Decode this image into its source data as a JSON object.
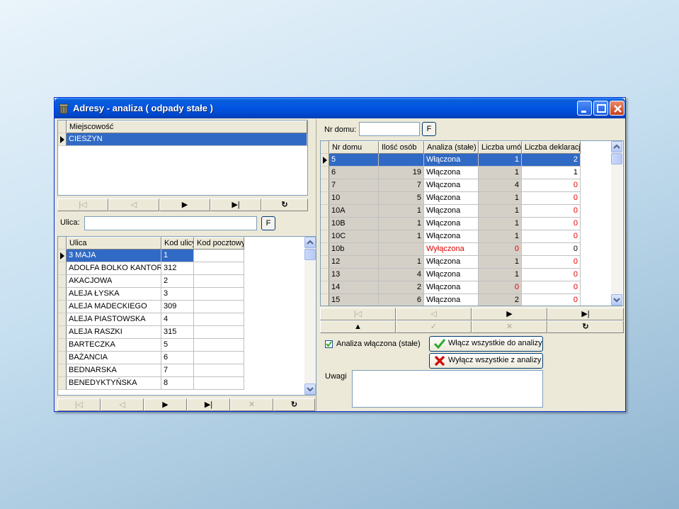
{
  "window": {
    "title": "Adresy - analiza ( odpady stałe )"
  },
  "miejscowosc": {
    "header": "Miejscowość",
    "rows": [
      "CIESZYN"
    ]
  },
  "nav_symbols": {
    "first": "|◁",
    "prior": "◁",
    "next": "▶",
    "last": "▶|",
    "refresh": "↻",
    "insert": "▲",
    "post": "✓",
    "cancel": "✕"
  },
  "ulica_filter": {
    "label": "Ulica:",
    "value": "",
    "button": "F"
  },
  "ulice": {
    "headers": [
      "Ulica",
      "Kod ulicy",
      "Kod pocztowy"
    ],
    "rows": [
      [
        "3 MAJA",
        "1",
        ""
      ],
      [
        "ADOLFA BOLKO KANTOR",
        "312",
        ""
      ],
      [
        "AKACJOWA",
        "2",
        ""
      ],
      [
        "ALEJA ŁYSKA",
        "3",
        ""
      ],
      [
        "ALEJA MADECKIEGO",
        "309",
        ""
      ],
      [
        "ALEJA PIASTOWSKA",
        "4",
        ""
      ],
      [
        "ALEJA RASZKI",
        "315",
        ""
      ],
      [
        "BARTECZKA",
        "5",
        ""
      ],
      [
        "BAŻANCIA",
        "6",
        ""
      ],
      [
        "BEDNARSKA",
        "7",
        ""
      ],
      [
        "BENEDYKTYŃSKA",
        "8",
        ""
      ]
    ]
  },
  "nr_domu_filter": {
    "label": "Nr domu:",
    "value": "",
    "button": "F"
  },
  "domy": {
    "headers": [
      "Nr domu",
      "Ilość osób",
      "Analiza (stałe)",
      "Liczba umów",
      "Liczba deklaracji"
    ],
    "rows": [
      {
        "nr": "5",
        "osoby": "",
        "analiza": "Włączona",
        "umowy": "1",
        "deklaracje": "2",
        "off": false,
        "umowy_red": false,
        "dekl_red": false
      },
      {
        "nr": "6",
        "osoby": "19",
        "analiza": "Włączona",
        "umowy": "1",
        "deklaracje": "1",
        "off": false,
        "umowy_red": false,
        "dekl_red": false
      },
      {
        "nr": "7",
        "osoby": "7",
        "analiza": "Włączona",
        "umowy": "4",
        "deklaracje": "0",
        "off": false,
        "umowy_red": false,
        "dekl_red": true
      },
      {
        "nr": "10",
        "osoby": "5",
        "analiza": "Włączona",
        "umowy": "1",
        "deklaracje": "0",
        "off": false,
        "umowy_red": false,
        "dekl_red": true
      },
      {
        "nr": "10A",
        "osoby": "1",
        "analiza": "Włączona",
        "umowy": "1",
        "deklaracje": "0",
        "off": false,
        "umowy_red": false,
        "dekl_red": true
      },
      {
        "nr": "10B",
        "osoby": "1",
        "analiza": "Włączona",
        "umowy": "1",
        "deklaracje": "0",
        "off": false,
        "umowy_red": false,
        "dekl_red": true
      },
      {
        "nr": "10C",
        "osoby": "1",
        "analiza": "Włączona",
        "umowy": "1",
        "deklaracje": "0",
        "off": false,
        "umowy_red": false,
        "dekl_red": true
      },
      {
        "nr": "10b",
        "osoby": "",
        "analiza": "Wyłączona",
        "umowy": "0",
        "deklaracje": "0",
        "off": true,
        "umowy_red": true,
        "dekl_red": false
      },
      {
        "nr": "12",
        "osoby": "1",
        "analiza": "Włączona",
        "umowy": "1",
        "deklaracje": "0",
        "off": false,
        "umowy_red": false,
        "dekl_red": true
      },
      {
        "nr": "13",
        "osoby": "4",
        "analiza": "Włączona",
        "umowy": "1",
        "deklaracje": "0",
        "off": false,
        "umowy_red": false,
        "dekl_red": true
      },
      {
        "nr": "14",
        "osoby": "2",
        "analiza": "Włączona",
        "umowy": "0",
        "deklaracje": "0",
        "off": false,
        "umowy_red": true,
        "dekl_red": true
      },
      {
        "nr": "15",
        "osoby": "6",
        "analiza": "Włączona",
        "umowy": "2",
        "deklaracje": "0",
        "off": false,
        "umowy_red": false,
        "dekl_red": true
      }
    ]
  },
  "options": {
    "checkbox_label": "Analiza włączona (stałe)",
    "checkbox_checked": true,
    "enable_all": "Włącz wszystkie do analizy",
    "disable_all": "Wyłącz wszystkie z analizy",
    "uwagi_label": "Uwagi",
    "uwagi_value": ""
  },
  "colors": {
    "selection": "#316ac5",
    "warning_red": "#e00000",
    "titlebar": "#0054e3"
  }
}
